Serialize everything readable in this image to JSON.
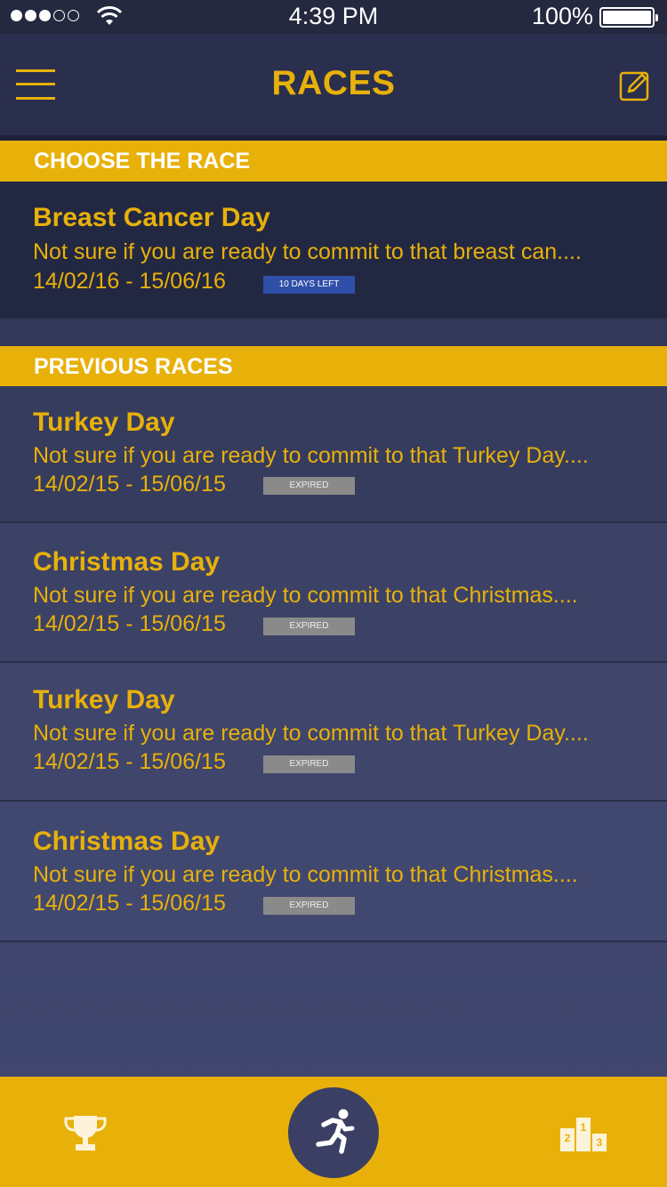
{
  "status_bar": {
    "time": "4:39 PM",
    "battery": "100%"
  },
  "header": {
    "title": "RACES"
  },
  "sections": {
    "current": {
      "title": "CHOOSE THE RACE"
    },
    "previous": {
      "title": "PREVIOUS RACES"
    }
  },
  "current_race": {
    "title": "Breast Cancer Day",
    "description": "Not sure if you are ready to commit to that breast can....",
    "dates": "14/02/16 - 15/06/16",
    "badge": "10 DAYS LEFT"
  },
  "previous_races": [
    {
      "title": "Turkey Day",
      "description": "Not sure if you are ready to commit to that Turkey Day....",
      "dates": "14/02/15 - 15/06/15",
      "badge": "EXPIRED"
    },
    {
      "title": "Christmas Day",
      "description": "Not sure if you are ready to commit to that Christmas....",
      "dates": "14/02/15 - 15/06/15",
      "badge": "EXPIRED"
    },
    {
      "title": "Turkey Day",
      "description": "Not sure if you are ready to commit to that Turkey Day....",
      "dates": "14/02/15 - 15/06/15",
      "badge": "EXPIRED"
    },
    {
      "title": "Christmas Day",
      "description": "Not sure if you are ready to commit to that Christmas....",
      "dates": "14/02/15 - 15/06/15",
      "badge": "EXPIRED"
    }
  ],
  "tab_bar": {
    "podium_labels": [
      "2",
      "1",
      "3"
    ]
  },
  "icons": {
    "menu": "hamburger-icon",
    "edit": "edit-icon",
    "trophy": "trophy-icon",
    "run": "runner-icon",
    "podium": "podium-icon"
  },
  "colors": {
    "accent": "#e8b10a",
    "background": "#2a2f4d",
    "badge_active": "#2f4fa8",
    "badge_expired": "#8a8a8a"
  }
}
